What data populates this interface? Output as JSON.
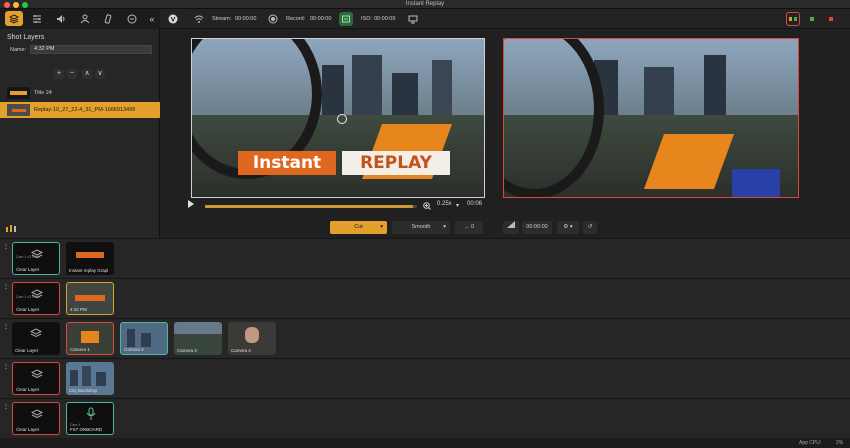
{
  "window": {
    "title": "Instant Replay"
  },
  "sidebar": {
    "panel_title": "Shot Layers",
    "name_label": "Name:",
    "name_value": "4:32 PM",
    "buttons": {
      "add": "+",
      "remove": "−",
      "up": "∧",
      "down": "∨"
    },
    "layers": [
      {
        "label": "Title 24"
      },
      {
        "label": "Replay-10_27_22-4_31_PM-1666913499"
      }
    ]
  },
  "toolbar": {
    "stream_label": "Stream:",
    "stream_time": "00:00:00",
    "record_label": "Record:",
    "record_time": "00:00:00",
    "iso_label": "ISO:",
    "iso_time": "00:00:09"
  },
  "preview": {
    "banner_left": "Instant",
    "banner_right": "REPLAY",
    "speed": "0.25x",
    "remaining": "00:06"
  },
  "transitions": {
    "cut_label": "Cut",
    "smooth_label": "Smooth",
    "arrow_label": "→",
    "arrow_value": "0",
    "live_time": "00:00:00"
  },
  "rows": [
    {
      "shots": [
        {
          "label": "Clear Layer",
          "tag": "Cam 1 c3 Patio"
        },
        {
          "label": "Instant replay Grapl"
        }
      ]
    },
    {
      "shots": [
        {
          "label": "Clear Layer",
          "tag": "Cam 1 c3 Patio"
        },
        {
          "label": "4:32 PM"
        }
      ]
    },
    {
      "shots": [
        {
          "label": "Clear Layer"
        },
        {
          "label": "Camera 1"
        },
        {
          "label": "Camera 2"
        },
        {
          "label": "Camera 3"
        },
        {
          "label": "Camera 4"
        }
      ]
    },
    {
      "shots": [
        {
          "label": "Clear Layer"
        },
        {
          "label": "City Backdrop"
        }
      ]
    },
    {
      "shots": [
        {
          "label": "Clear Layer"
        },
        {
          "label": "FS7 ONBOARD",
          "tag": "Cam 4"
        }
      ]
    }
  ],
  "status": {
    "cpu_label": "App CPU:",
    "cpu_value": "2%"
  },
  "colors": {
    "accent": "#e3a12c",
    "selected_border": "#4fb3a6",
    "live_border": "#d94a3d"
  }
}
